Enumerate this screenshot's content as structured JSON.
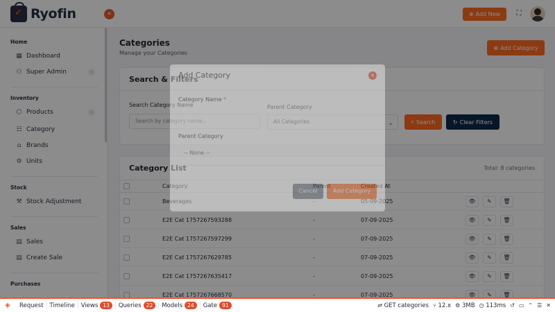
{
  "brand": {
    "name": "Ryofin",
    "accent": "#ff6a21",
    "navy": "#0d2a4a"
  },
  "header": {
    "add_new_label": "Add New",
    "collapse_icon": "«",
    "expand_icon": "⛶"
  },
  "sidebar": {
    "sections": [
      {
        "title": "Home"
      },
      {
        "title": "Inventory"
      },
      {
        "title": "Stock"
      },
      {
        "title": "Sales"
      },
      {
        "title": "Purchases"
      }
    ],
    "items": [
      {
        "label": "Dashboard",
        "icon": "▦"
      },
      {
        "label": "Super Admin",
        "icon": "⚇"
      },
      {
        "label": "Products",
        "icon": "⬡"
      },
      {
        "label": "Category",
        "icon": "☷"
      },
      {
        "label": "Brands",
        "icon": "⌂"
      },
      {
        "label": "Units",
        "icon": "⚙"
      },
      {
        "label": "Stock Adjustment",
        "icon": "⚒"
      },
      {
        "label": "Sales",
        "icon": "▤"
      },
      {
        "label": "Create Sale",
        "icon": "▤"
      }
    ]
  },
  "page": {
    "title": "Categories",
    "subtitle": "Manage your Categories",
    "add_button": "Add Category"
  },
  "filters": {
    "title": "Search & Filters",
    "search_label": "Search Category Name",
    "search_placeholder": "Search by category name...",
    "parent_label": "Parent Category",
    "parent_value": "All Categories",
    "search_button": "Search",
    "clear_button": "Clear Filters"
  },
  "list": {
    "title": "Category List",
    "total": "Total: 8 categories",
    "columns": {
      "category": "Category",
      "parent": "Parent",
      "created": "Created At"
    },
    "rows": [
      {
        "name": "Beverages",
        "parent": "-",
        "created": "05-09-2025"
      },
      {
        "name": "E2E Cat 1757267593288",
        "parent": "-",
        "created": "07-09-2025"
      },
      {
        "name": "E2E Cat 1757267597299",
        "parent": "-",
        "created": "07-09-2025"
      },
      {
        "name": "E2E Cat 1757267629785",
        "parent": "-",
        "created": "07-09-2025"
      },
      {
        "name": "E2E Cat 1757267635417",
        "parent": "-",
        "created": "07-09-2025"
      },
      {
        "name": "E2E Cat 1757267668570",
        "parent": "-",
        "created": "07-09-2025"
      }
    ]
  },
  "modal": {
    "title": "Add Category",
    "name_label": "Category Name",
    "required_mark": "*",
    "parent_label": "Parent Category",
    "parent_value": "-- None --",
    "cancel": "Cancel",
    "submit": "Add Category"
  },
  "debugbar": {
    "tabs": [
      {
        "label": "Request"
      },
      {
        "label": "Timeline"
      },
      {
        "label": "Views",
        "count": "13"
      },
      {
        "label": "Queries",
        "count": "22"
      },
      {
        "label": "Models",
        "count": "24"
      },
      {
        "label": "Gate",
        "count": "91"
      }
    ],
    "route": "GET categories",
    "version": "12.x",
    "memory": "3MB",
    "time": "113ms"
  }
}
